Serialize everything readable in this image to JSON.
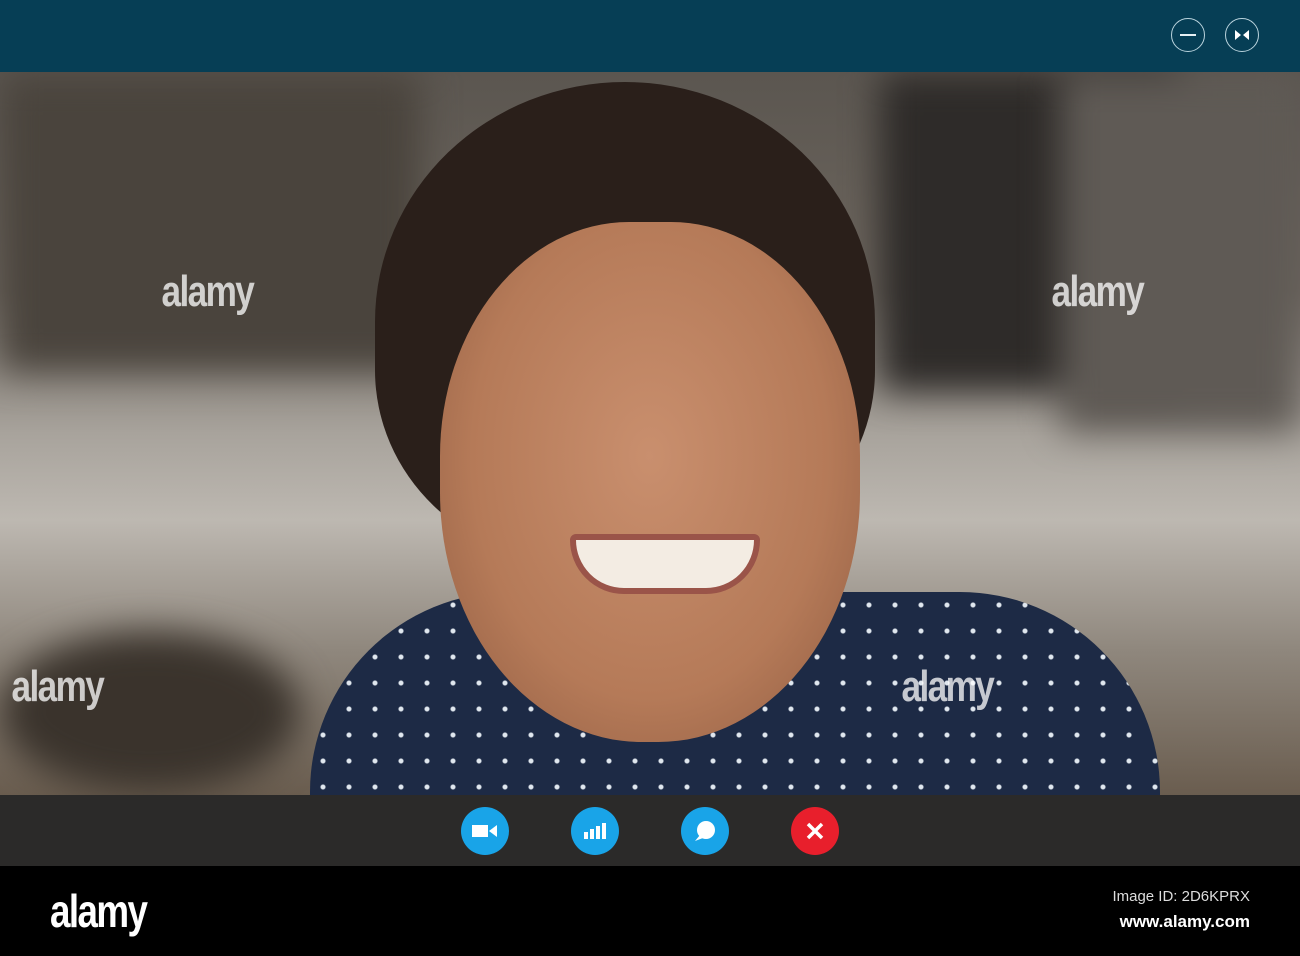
{
  "window": {
    "minimize_icon": "minus-circle-icon",
    "restore_icon": "bowtie-collapse-icon"
  },
  "controls": [
    {
      "name": "video-camera-button",
      "icon": "video-camera-icon",
      "color": "#19a4e8"
    },
    {
      "name": "signal-button",
      "icon": "signal-bars-icon",
      "color": "#19a4e8"
    },
    {
      "name": "chat-button",
      "icon": "chat-bubble-icon",
      "color": "#19a4e8"
    },
    {
      "name": "end-call-button",
      "icon": "close-x-icon",
      "color": "#e81f2c"
    }
  ],
  "watermark": "alamy",
  "footer": {
    "logo": "alamy",
    "image_id": "Image ID: 2D6KPRX",
    "site": "www.alamy.com"
  }
}
